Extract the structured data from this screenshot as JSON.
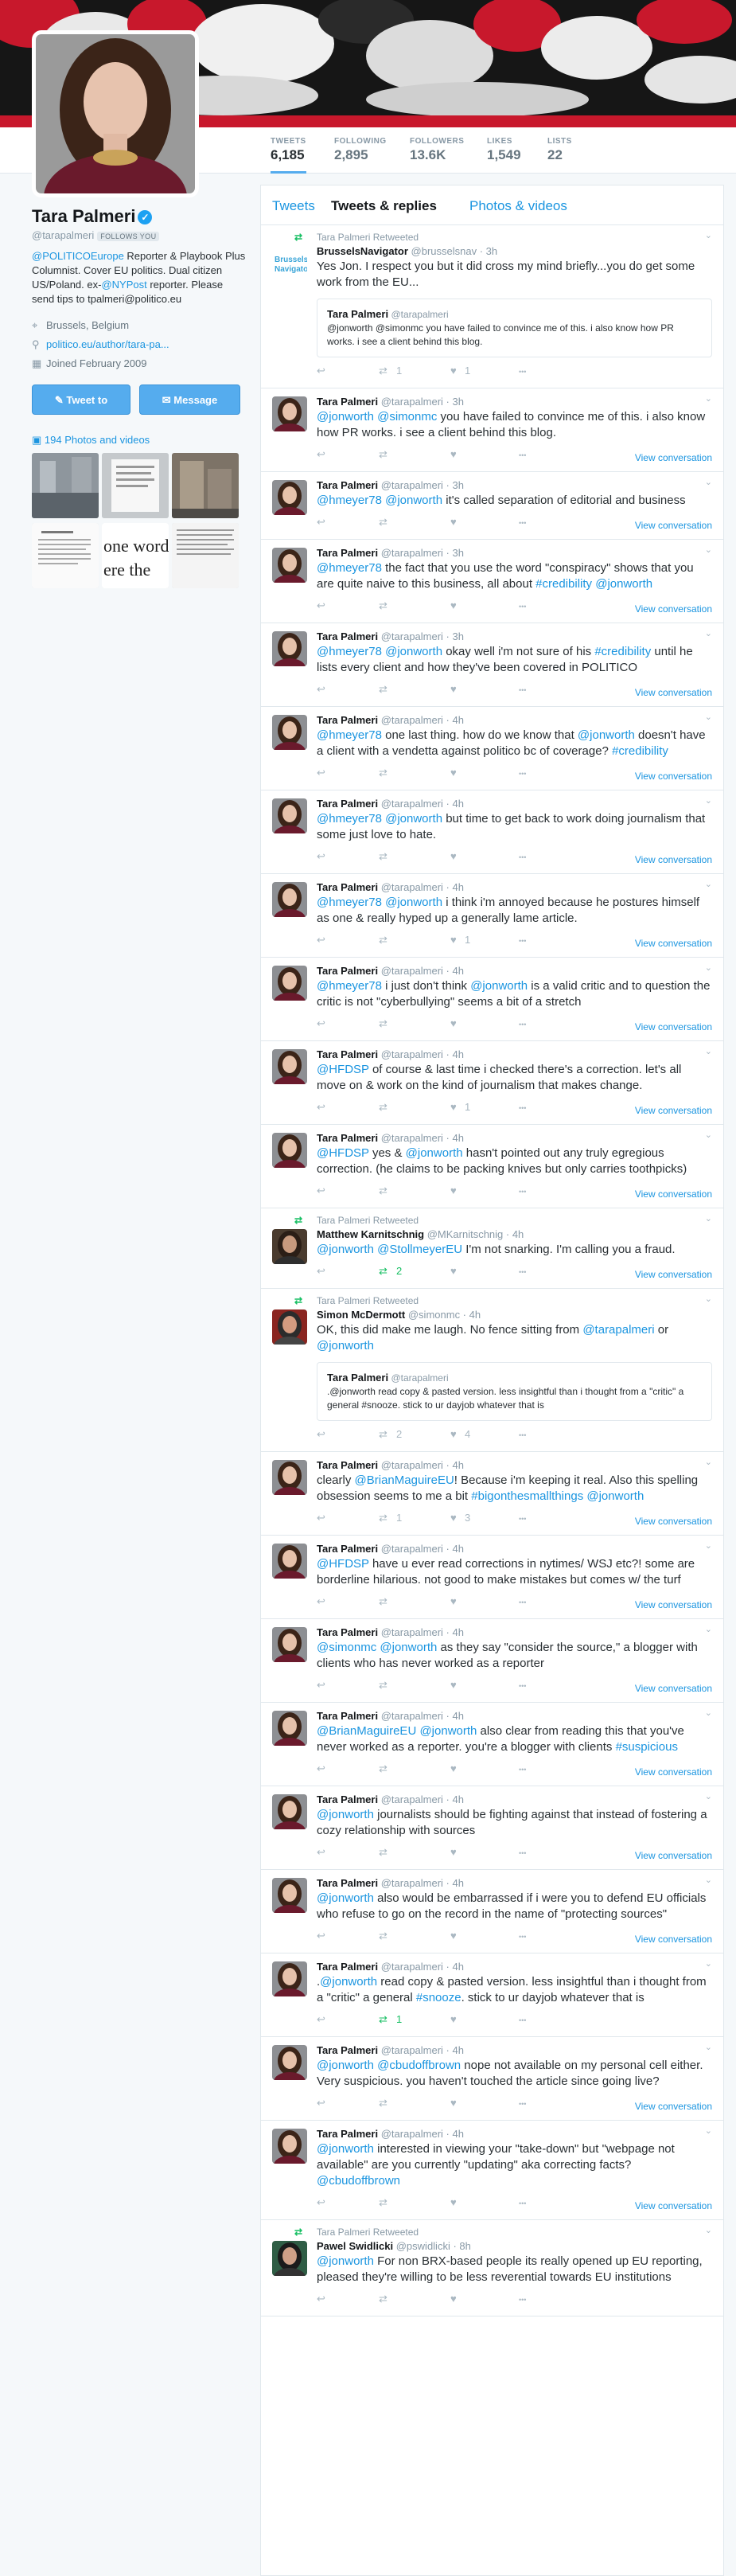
{
  "nav": {
    "stats": [
      {
        "label": "TWEETS",
        "value": "6,185"
      },
      {
        "label": "FOLLOWING",
        "value": "2,895"
      },
      {
        "label": "FOLLOWERS",
        "value": "13.6K"
      },
      {
        "label": "LIKES",
        "value": "1,549"
      },
      {
        "label": "LISTS",
        "value": "22"
      }
    ]
  },
  "profile": {
    "name": "Tara Palmeri",
    "handle": "@tarapalmeri",
    "follows_you": "FOLLOWS YOU",
    "bio_part1": "@POLITICOEurope",
    "bio_part2": " Reporter & Playbook Plus Columnist. Cover EU politics. Dual citizen US/Poland. ex-",
    "bio_part3": "@NYPost",
    "bio_part4": " reporter. Please send tips to tpalmeri@politico.eu",
    "location": "Brussels, Belgium",
    "url": "politico.eu/author/tara-pa...",
    "joined": "Joined February 2009",
    "tweet_to": "Tweet to",
    "message": "Message",
    "photos_label": "194 Photos and videos"
  },
  "tabs": [
    "Tweets",
    "Tweets & replies",
    "Photos & videos"
  ],
  "actions": {
    "view_conversation": "View conversation"
  },
  "tweets": [
    {
      "retweeted_by": "Tara Palmeri Retweeted",
      "name": "BrusselsNavigator",
      "handle": "@brusselsnav · 3h",
      "text": "Yes Jon. I respect you but it did cross my mind briefly...you do get some work from the EU...",
      "quote_name": "Tara Palmeri",
      "quote_handle": "@tarapalmeri",
      "quote_text": "@jonworth @simonmc you have failed to convince me of this. i also know how PR works. i see a client behind this blog.",
      "rts": "1",
      "likes": "1",
      "vc": ""
    },
    {
      "name": "Tara Palmeri",
      "handle": "@tarapalmeri · 3h",
      "text": "@jonworth @simonmc you have failed to convince me of this. i also know how PR works. i see a client behind this blog.",
      "rts": "",
      "likes": "",
      "vc": "View conversation"
    },
    {
      "name": "Tara Palmeri",
      "handle": "@tarapalmeri · 3h",
      "text": "@hmeyer78 @jonworth it's called separation of editorial and business",
      "rts": "",
      "likes": "",
      "vc": "View conversation"
    },
    {
      "name": "Tara Palmeri",
      "handle": "@tarapalmeri · 3h",
      "text": "@hmeyer78 the fact that you use the word \"conspiracy\" shows that you are quite naive to this business, all about #credibility @jonworth",
      "rts": "",
      "likes": "",
      "vc": "View conversation"
    },
    {
      "name": "Tara Palmeri",
      "handle": "@tarapalmeri · 3h",
      "text": "@hmeyer78 @jonworth okay well i'm not sure of his #credibility until he lists every client and how they've been covered in POLITICO",
      "rts": "",
      "likes": "",
      "vc": "View conversation"
    },
    {
      "name": "Tara Palmeri",
      "handle": "@tarapalmeri · 4h",
      "text": "@hmeyer78 one last thing. how do we know that @jonworth doesn't have a client with a vendetta against politico bc of coverage? #credibility",
      "rts": "",
      "likes": "",
      "vc": "View conversation"
    },
    {
      "name": "Tara Palmeri",
      "handle": "@tarapalmeri · 4h",
      "text": "@hmeyer78 @jonworth but time to get back to work doing journalism that some just love to hate.",
      "rts": "",
      "likes": "",
      "vc": "View conversation"
    },
    {
      "name": "Tara Palmeri",
      "handle": "@tarapalmeri · 4h",
      "text": "@hmeyer78 @jonworth i think i'm annoyed because he postures himself as one & really hyped up a generally lame article.",
      "rts": "",
      "likes": "1",
      "vc": "View conversation"
    },
    {
      "name": "Tara Palmeri",
      "handle": "@tarapalmeri · 4h",
      "text": "@hmeyer78 i just don't think @jonworth is a valid critic and to question the critic is not \"cyberbullying\" seems a bit of a stretch",
      "rts": "",
      "likes": "",
      "vc": "View conversation"
    },
    {
      "name": "Tara Palmeri",
      "handle": "@tarapalmeri · 4h",
      "text": "@HFDSP of course & last time i checked there's a correction. let's all move on & work on the kind of journalism that makes change.",
      "rts": "",
      "likes": "1",
      "vc": "View conversation"
    },
    {
      "name": "Tara Palmeri",
      "handle": "@tarapalmeri · 4h",
      "text": "@HFDSP yes & @jonworth hasn't pointed out any truly egregious correction. (he claims to be packing knives but only carries toothpicks)",
      "rts": "",
      "likes": "",
      "vc": "View conversation"
    },
    {
      "retweeted_by": "Tara Palmeri Retweeted",
      "name": "Matthew Karnitschnig",
      "handle": "@MKarnitschnig · 4h",
      "text": "@jonworth @StollmeyerEU I'm not snarking. I'm calling you a fraud.",
      "rts": "2",
      "rt_green": true,
      "likes": "",
      "vc": "View conversation"
    },
    {
      "retweeted_by": "Tara Palmeri Retweeted",
      "name": "Simon McDermott",
      "handle": "@simonmc · 4h",
      "text": "OK, this did make me laugh. No fence sitting from @tarapalmeri or @jonworth",
      "quote_name": "Tara Palmeri",
      "quote_handle": "@tarapalmeri",
      "quote_text": ".@jonworth read copy & pasted version. less insightful than i thought from a \"critic\" a general #snooze. stick to ur dayjob whatever that is",
      "rts": "2",
      "likes": "4",
      "vc": ""
    },
    {
      "name": "Tara Palmeri",
      "handle": "@tarapalmeri · 4h",
      "text": "clearly @BrianMaguireEU! Because i'm keeping it real. Also this spelling obsession seems to me a bit #bigonthesmallthings @jonworth",
      "rts": "1",
      "likes": "3",
      "vc": "View conversation"
    },
    {
      "name": "Tara Palmeri",
      "handle": "@tarapalmeri · 4h",
      "text": "@HFDSP have u ever read corrections in nytimes/ WSJ etc?! some are borderline hilarious. not good to make mistakes but comes w/ the turf",
      "rts": "",
      "likes": "",
      "vc": "View conversation"
    },
    {
      "name": "Tara Palmeri",
      "handle": "@tarapalmeri · 4h",
      "text": "@simonmc @jonworth as they say \"consider the source,\" a blogger with clients who has never worked as a reporter",
      "rts": "",
      "likes": "",
      "vc": "View conversation"
    },
    {
      "name": "Tara Palmeri",
      "handle": "@tarapalmeri · 4h",
      "text": "@BrianMaguireEU @jonworth also clear from reading this that you've never worked as a reporter. you're a blogger with clients #suspicious",
      "rts": "",
      "likes": "",
      "vc": "View conversation"
    },
    {
      "name": "Tara Palmeri",
      "handle": "@tarapalmeri · 4h",
      "text": "@jonworth journalists should be fighting against that instead of fostering a cozy relationship with sources",
      "rts": "",
      "likes": "",
      "vc": "View conversation"
    },
    {
      "name": "Tara Palmeri",
      "handle": "@tarapalmeri · 4h",
      "text": "@jonworth also would be embarrassed if i were you to defend EU officials who refuse to go on the record in the name of \"protecting sources\"",
      "rts": "",
      "likes": "",
      "vc": "View conversation"
    },
    {
      "name": "Tara Palmeri",
      "handle": "@tarapalmeri · 4h",
      "text": ".@jonworth read copy & pasted version. less insightful than i thought from a \"critic\" a general #snooze. stick to ur dayjob whatever that is",
      "rts": "1",
      "rt_green": true,
      "likes": "",
      "vc": ""
    },
    {
      "name": "Tara Palmeri",
      "handle": "@tarapalmeri · 4h",
      "text": "@jonworth @cbudoffbrown nope not available on my personal cell either. Very suspicious. you haven't touched the article since going live?",
      "rts": "",
      "likes": "",
      "vc": "View conversation"
    },
    {
      "name": "Tara Palmeri",
      "handle": "@tarapalmeri · 4h",
      "text": "@jonworth interested in viewing your \"take-down\" but \"webpage not available\" are you currently \"updating\" aka correcting facts?@cbudoffbrown",
      "rts": "",
      "likes": "",
      "vc": "View conversation"
    },
    {
      "retweeted_by": "Tara Palmeri Retweeted",
      "name": "Pawel Swidlicki",
      "handle": "@pswidlicki · 8h",
      "text": "@jonworth For non BRX-based people its really opened up EU reporting, pleased they're willing to be less reverential towards EU institutions",
      "rts": "",
      "likes": "",
      "vc": ""
    }
  ]
}
